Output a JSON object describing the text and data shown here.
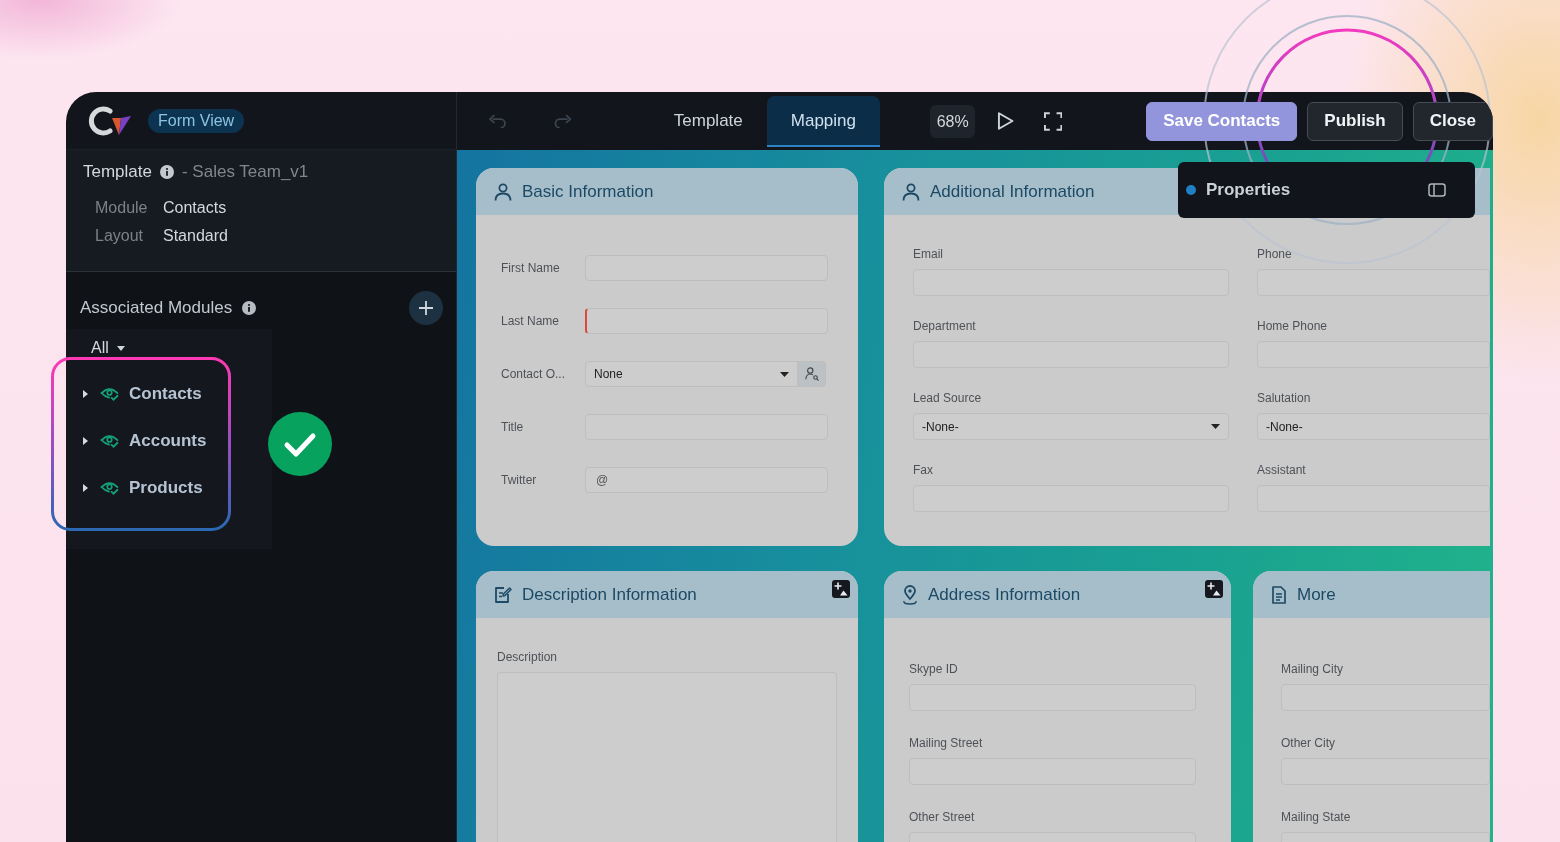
{
  "app": {
    "badge": "Form View"
  },
  "template_info": {
    "label": "Template",
    "name": "- Sales Team_v1",
    "details": [
      {
        "label": "Module",
        "value": "Contacts"
      },
      {
        "label": "Layout",
        "value": "Standard"
      }
    ]
  },
  "associated_modules": {
    "title": "Associated Modules",
    "filter": "All",
    "items": [
      {
        "label": "Contacts",
        "expanded": false
      },
      {
        "label": "Accounts",
        "expanded": false
      },
      {
        "label": "Products",
        "expanded": false
      }
    ]
  },
  "toolbar": {
    "tabs": [
      {
        "label": "Template",
        "selected": false
      },
      {
        "label": "Mapping",
        "selected": true
      }
    ],
    "zoom": "68%",
    "buttons": [
      {
        "label": "Save Contacts",
        "kind": "primary"
      },
      {
        "label": "Publish",
        "kind": "secondary"
      },
      {
        "label": "Close",
        "kind": "secondary"
      }
    ]
  },
  "properties_panel": {
    "title": "Properties"
  },
  "sections": [
    {
      "title": "Basic Information",
      "kind": "inline",
      "image_button": false,
      "fields": [
        {
          "label": "First Name",
          "kind": "text",
          "required": false
        },
        {
          "label": "Last Name",
          "kind": "text",
          "required": true
        },
        {
          "label": "Contact O...",
          "kind": "lookup",
          "value": "None",
          "required": false
        },
        {
          "label": "Title",
          "kind": "text",
          "required": false
        },
        {
          "label": "Twitter",
          "kind": "text",
          "prefix": "@",
          "required": false
        }
      ]
    },
    {
      "title": "Additional Information",
      "kind": "grid",
      "image_button": false,
      "fields": [
        {
          "label": "Email",
          "kind": "text"
        },
        {
          "label": "Phone",
          "kind": "text"
        },
        {
          "label": "Department",
          "kind": "text"
        },
        {
          "label": "Home Phone",
          "kind": "text"
        },
        {
          "label": "Lead Source",
          "kind": "select",
          "value": "-None-"
        },
        {
          "label": "Salutation",
          "kind": "text",
          "value": "-None-"
        },
        {
          "label": "Fax",
          "kind": "text"
        },
        {
          "label": "Assistant",
          "kind": "text"
        }
      ]
    },
    {
      "title": "Description Information",
      "kind": "stacked",
      "image_button": true,
      "fields": [
        {
          "label": "Description",
          "kind": "textarea"
        }
      ]
    },
    {
      "title": "Address Information",
      "kind": "stacked",
      "image_button": true,
      "fields": [
        {
          "label": "Skype ID",
          "kind": "text"
        },
        {
          "label": "Mailing Street",
          "kind": "text"
        },
        {
          "label": "Other Street",
          "kind": "text"
        }
      ]
    },
    {
      "title": "More",
      "kind": "stacked",
      "image_button": false,
      "fields": [
        {
          "label": "Mailing City",
          "kind": "text"
        },
        {
          "label": "Other City",
          "kind": "text"
        },
        {
          "label": "Mailing State",
          "kind": "text"
        }
      ]
    }
  ]
}
